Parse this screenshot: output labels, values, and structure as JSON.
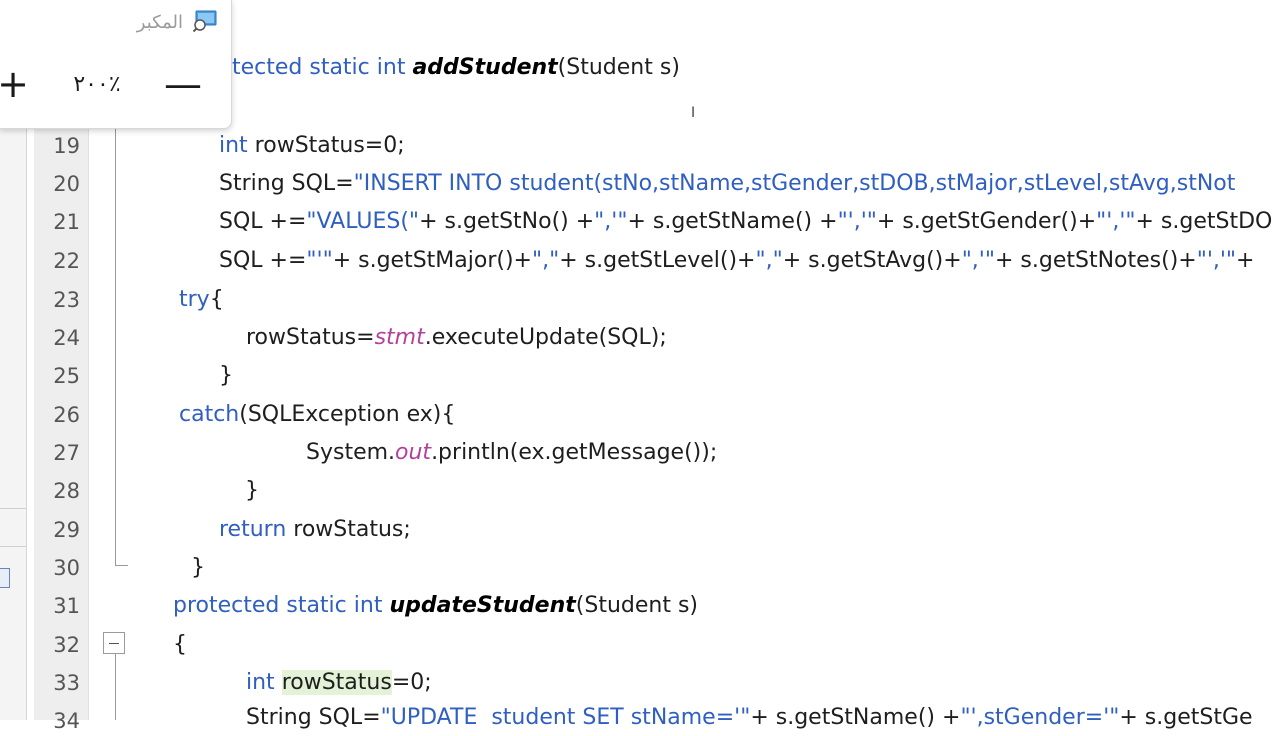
{
  "zoom_popup": {
    "title": "المكبر",
    "minus_label": "—",
    "level": "٢٠٠٪",
    "plus_label": "+"
  },
  "line_numbers": [
    "19",
    "20",
    "21",
    "22",
    "23",
    "24",
    "25",
    "26",
    "27",
    "28",
    "29",
    "30",
    "31",
    "32",
    "33",
    "34"
  ],
  "code": {
    "l18": {
      "kw": "protected static int",
      "name": "addStudent",
      "params": "(Student s)"
    },
    "l19": {
      "kw": "int",
      "rest": " rowStatus=0;"
    },
    "l20": {
      "pre": "String SQL=",
      "str": "\"INSERT INTO student(stNo,stName,stGender,stDOB,stMajor,stLevel,stAvg,stNot"
    },
    "l21": {
      "pre": "SQL +=",
      "s1": "\"VALUES(\"",
      "p1": "+ s.getStNo() +",
      "s2": "\",'\"",
      "p2": "+ s.getStName() +",
      "s3": "\"','\"",
      "p3": "+ s.getStGender()+",
      "s4": "\"','\"",
      "p4": "+ s.getStDO"
    },
    "l22": {
      "pre": "SQL +=",
      "s1": "\"'\"",
      "p1": "+ s.getStMajor()+",
      "s2": "\",\"",
      "p2": "+ s.getStLevel()+",
      "s3": "\",\"",
      "p3": "+ s.getStAvg()+",
      "s4": "\",'\"",
      "p4": "+ s.getStNotes()+",
      "s5": "\"','\"",
      "p5": "+"
    },
    "l23": {
      "kw": "try",
      "rest": "{"
    },
    "l24": {
      "pre": "rowStatus=",
      "field": "stmt",
      "post": ".executeUpdate(SQL);"
    },
    "l25": {
      "text": "}"
    },
    "l26": {
      "kw": "catch",
      "rest": "(SQLException ex){"
    },
    "l27": {
      "pre": "System.",
      "field": "out",
      "post": ".println(ex.getMessage());"
    },
    "l28": {
      "text": "}"
    },
    "l29": {
      "kw": "return",
      "rest": " rowStatus;"
    },
    "l30": {
      "text": "}"
    },
    "l31": {
      "kw": "protected static int",
      "name": "updateStudent",
      "params": "(Student s)"
    },
    "l32": {
      "text": "{"
    },
    "l33": {
      "kw": "int",
      "hl": "rowStatus",
      "rest": "=0;"
    },
    "l34": {
      "pre": "String SQL=",
      "str": "\"UPDATE  student SET stName='\"",
      "p1": "+ s.getStName() +",
      "s2": "\"',stGender='\"",
      "p2": "+ s.getStGe"
    }
  },
  "colors": {
    "keyword": "#2f5fc0",
    "field": "#b3409b",
    "gutter": "#eeeeee",
    "highlight": "#e4f3d7"
  }
}
